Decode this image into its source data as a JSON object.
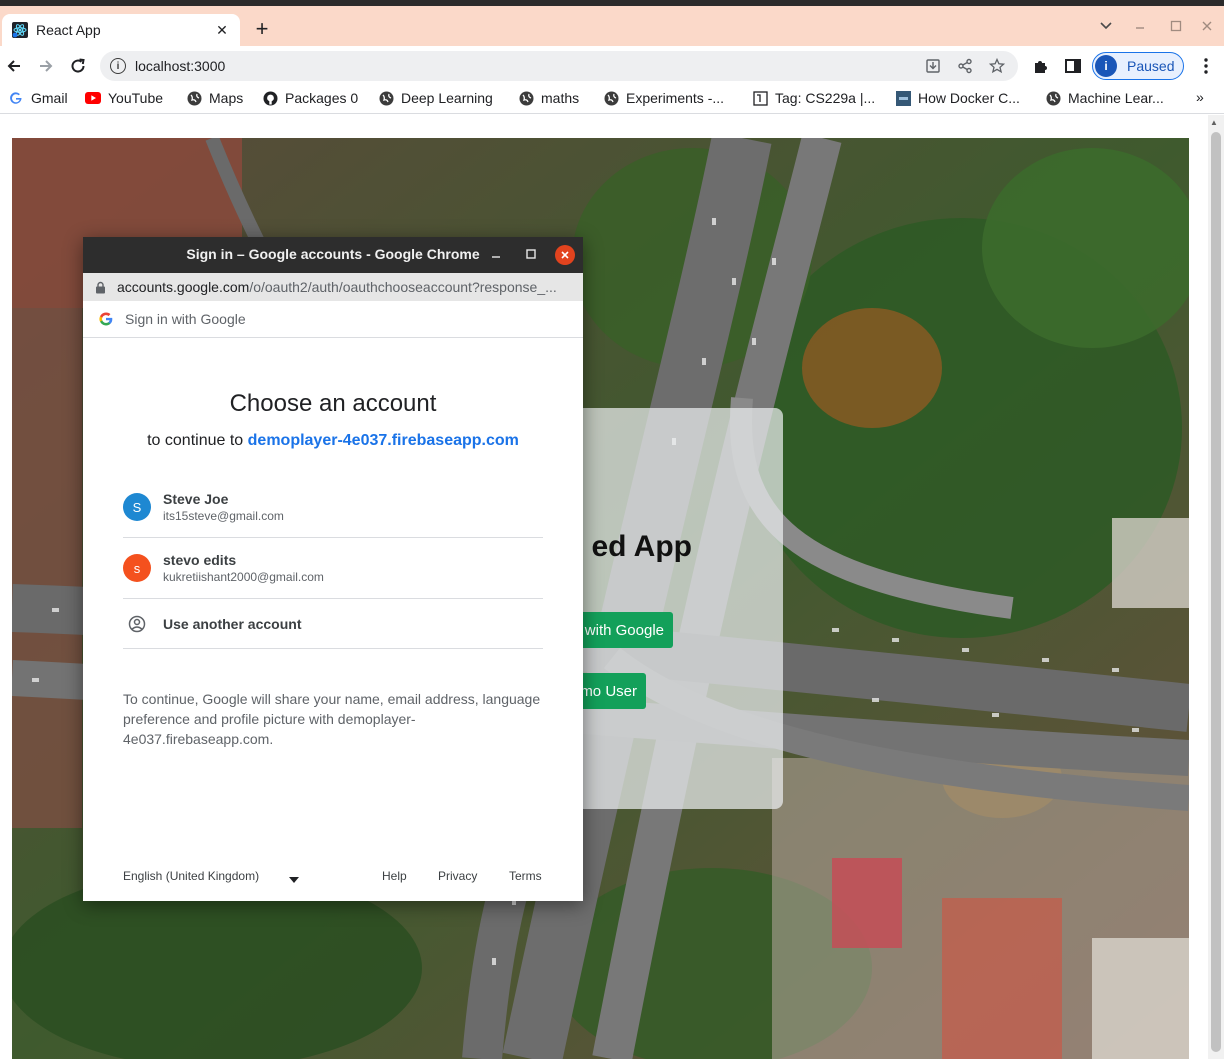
{
  "browser": {
    "tab_title": "React App",
    "tab_close": "✕",
    "new_tab": "+",
    "address": "localhost:3000",
    "profile_initial": "i",
    "profile_status": "Paused",
    "bookmarks": [
      {
        "label": "Gmail",
        "icon": "google-g-icon"
      },
      {
        "label": "YouTube",
        "icon": "youtube-icon"
      },
      {
        "label": "Maps",
        "icon": "globe-icon"
      },
      {
        "label": "Packages 0",
        "icon": "github-icon"
      },
      {
        "label": "Deep Learning",
        "icon": "globe-icon"
      },
      {
        "label": "maths",
        "icon": "globe-icon"
      },
      {
        "label": "Experiments -...",
        "icon": "globe-icon"
      },
      {
        "label": "Tag: CS229a |...",
        "icon": "document-icon"
      },
      {
        "label": "How Docker C...",
        "icon": "tds-icon"
      },
      {
        "label": "Machine Lear...",
        "icon": "globe-icon"
      }
    ],
    "more_bookmarks": "»"
  },
  "app": {
    "title_fragment": "ed App",
    "google_button_fragment": "with Google",
    "demo_button_fragment": "mo User"
  },
  "popup": {
    "window_title": "Sign in – Google accounts - Google Chrome",
    "url_host": "accounts.google.com",
    "url_path": "/o/oauth2/auth/oauthchooseaccount?response_...",
    "sign_in_with": "Sign in with Google",
    "heading": "Choose an account",
    "continue_prefix": "to continue to",
    "continue_app": "demoplayer-4e037.firebaseapp.com",
    "accounts": [
      {
        "initial": "S",
        "name": "Steve Joe",
        "email": "its15steve@gmail.com",
        "color": "#1e88d2"
      },
      {
        "initial": "s",
        "name": "stevo edits",
        "email": "kukretiishant2000@gmail.com",
        "color": "#f4511e"
      }
    ],
    "use_another": "Use another account",
    "disclaimer": "To continue, Google will share your name, email address, language preference and profile picture with demoplayer-4e037.firebaseapp.com.",
    "language": "English (United Kingdom)",
    "help": "Help",
    "privacy": "Privacy",
    "terms": "Terms"
  }
}
